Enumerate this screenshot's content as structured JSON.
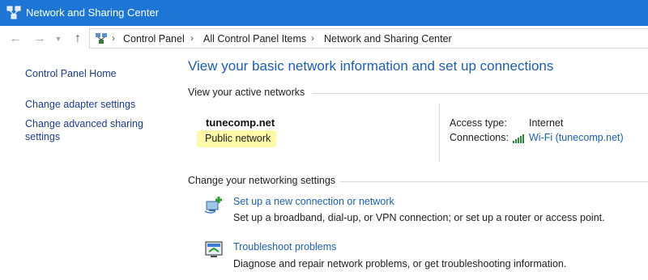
{
  "window": {
    "title": "Network and Sharing Center"
  },
  "address": {
    "crumbs": [
      "Control Panel",
      "All Control Panel Items",
      "Network and Sharing Center"
    ]
  },
  "sidebar": {
    "items": [
      {
        "label": "Control Panel Home"
      },
      {
        "label": "Change adapter settings"
      },
      {
        "label": "Change advanced sharing settings"
      }
    ]
  },
  "main": {
    "title": "View your basic network information and set up connections",
    "active_section": "View your active networks",
    "network": {
      "name": "tunecomp.net",
      "type": "Public network",
      "access_label": "Access type:",
      "access_value": "Internet",
      "connections_label": "Connections:",
      "connections_value": "Wi-Fi (tunecomp.net)"
    },
    "settings_section": "Change your networking settings",
    "tasks": [
      {
        "icon": "new-connection-icon",
        "link": "Set up a new connection or network",
        "desc": "Set up a broadband, dial-up, or VPN connection; or set up a router or access point."
      },
      {
        "icon": "troubleshoot-icon",
        "link": "Troubleshoot problems",
        "desc": "Diagnose and repair network problems, or get troubleshooting information."
      }
    ]
  },
  "colors": {
    "titlebar": "#1d76d6",
    "link": "#1d5fb2",
    "highlight": "#fffaa8"
  }
}
